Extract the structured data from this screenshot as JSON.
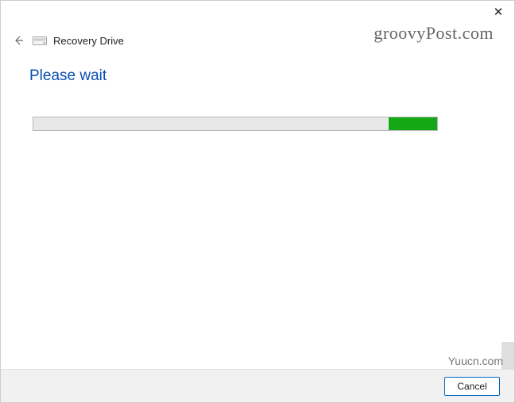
{
  "titlebar": {
    "close_glyph": "✕"
  },
  "header": {
    "back_arrow_glyph": "←",
    "window_title": "Recovery Drive"
  },
  "content": {
    "heading": "Please wait",
    "progress_percent": 12
  },
  "footer": {
    "cancel_label": "Cancel"
  },
  "watermarks": {
    "top": "groovyPost.com",
    "bottom": "Yuucn.com"
  },
  "colors": {
    "heading_blue": "#0a4db2",
    "progress_green": "#14a814",
    "button_border": "#0067c0"
  }
}
